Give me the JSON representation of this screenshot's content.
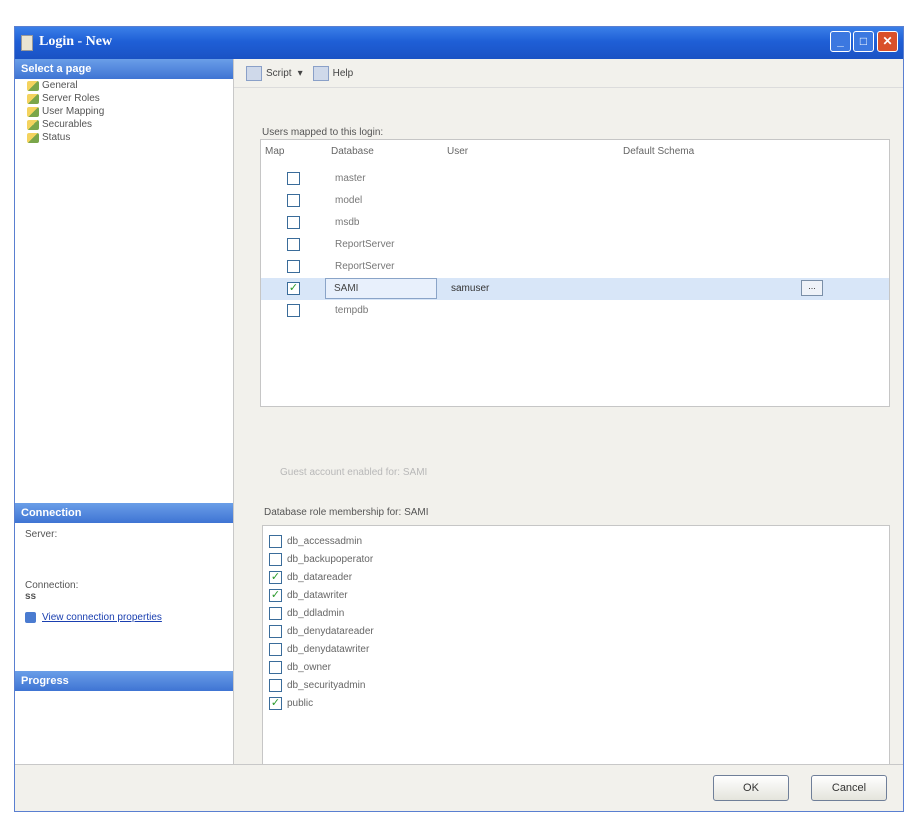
{
  "window": {
    "title": "Login - New",
    "min_glyph": "_",
    "max_glyph": "□",
    "close_glyph": "✕"
  },
  "left": {
    "select_page_header": "Select a page",
    "pages": [
      "General",
      "Server Roles",
      "User Mapping",
      "Securables",
      "Status"
    ],
    "connection_header": "Connection",
    "server_label": "Server:",
    "connection_label": "Connection:",
    "connection_value": "ss",
    "view_connection_link": "View connection properties",
    "progress_header": "Progress"
  },
  "toolbar": {
    "script_label": "Script",
    "script_dropdown": "▾",
    "help_label": "Help"
  },
  "mapping": {
    "title": "Users mapped to this login:",
    "headers": {
      "map": "Map",
      "database": "Database",
      "user": "User",
      "schema": "Default Schema"
    },
    "rows": [
      {
        "checked": "",
        "database": "master",
        "user": ""
      },
      {
        "checked": "",
        "database": "model",
        "user": ""
      },
      {
        "checked": "",
        "database": "msdb",
        "user": ""
      },
      {
        "checked": "",
        "database": "ReportServer",
        "user": ""
      },
      {
        "checked": "",
        "database": "ReportServer",
        "user": ""
      },
      {
        "checked": "✓",
        "database": "SAMI",
        "user": "samuser",
        "ellipsis": "..."
      },
      {
        "checked": "",
        "database": "tempdb",
        "user": ""
      }
    ]
  },
  "guest_label": "Guest account enabled for: SAMI",
  "roles": {
    "title": "Database role membership for: SAMI",
    "items": [
      {
        "name": "db_accessadmin",
        "checked": ""
      },
      {
        "name": "db_backupoperator",
        "checked": ""
      },
      {
        "name": "db_datareader",
        "checked": "✓"
      },
      {
        "name": "db_datawriter",
        "checked": "✓"
      },
      {
        "name": "db_ddladmin",
        "checked": ""
      },
      {
        "name": "db_denydatareader",
        "checked": ""
      },
      {
        "name": "db_denydatawriter",
        "checked": ""
      },
      {
        "name": "db_owner",
        "checked": ""
      },
      {
        "name": "db_securityadmin",
        "checked": ""
      },
      {
        "name": "public",
        "checked": "✓"
      }
    ]
  },
  "footer": {
    "ok_label": "OK",
    "cancel_label": "Cancel"
  }
}
